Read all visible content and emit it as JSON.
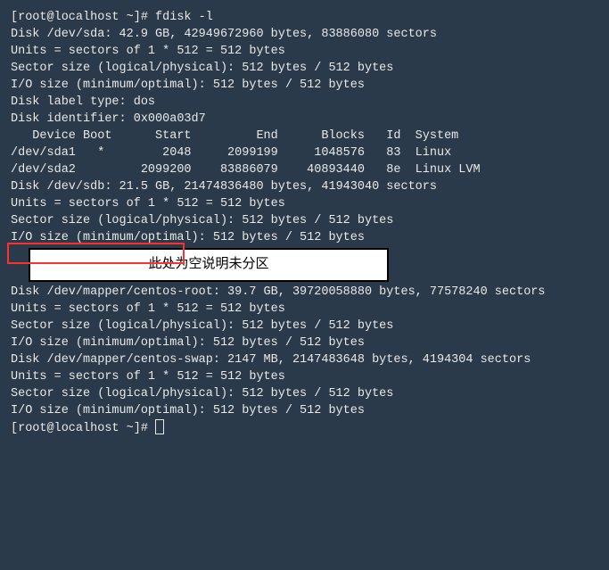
{
  "prompt1": "[root@localhost ~]# fdisk -l",
  "blank": "",
  "sda": {
    "disk": "Disk /dev/sda: 42.9 GB, 42949672960 bytes, 83886080 sectors",
    "units": "Units = sectors of 1 * 512 = 512 bytes",
    "sector": "Sector size (logical/physical): 512 bytes / 512 bytes",
    "io": "I/O size (minimum/optimal): 512 bytes / 512 bytes",
    "labeltype": "Disk label type: dos",
    "identifier": "Disk identifier: 0x000a03d7"
  },
  "partitions": {
    "header": "   Device Boot      Start         End      Blocks   Id  System",
    "p1": "/dev/sda1   *        2048     2099199     1048576   83  Linux",
    "p2": "/dev/sda2         2099200    83886079    40893440   8e  Linux LVM"
  },
  "sdb": {
    "disk_part1": "Disk /dev/sdb: 21.5 GB",
    "disk_part2": ", 21474836480 bytes, 41943040 sectors",
    "units": "Units = sectors of 1 * 512 = 512 bytes",
    "sector": "Sector size (logical/physical): 512 bytes / 512 bytes",
    "io": "I/O size (minimum/optimal): 512 bytes / 512 bytes"
  },
  "annotation": "此处为空说明未分区",
  "mapper_root": {
    "disk": "Disk /dev/mapper/centos-root: 39.7 GB, 39720058880 bytes, 77578240 sectors",
    "units": "Units = sectors of 1 * 512 = 512 bytes",
    "sector": "Sector size (logical/physical): 512 bytes / 512 bytes",
    "io": "I/O size (minimum/optimal): 512 bytes / 512 bytes"
  },
  "mapper_swap": {
    "disk": "Disk /dev/mapper/centos-swap: 2147 MB, 2147483648 bytes, 4194304 sectors",
    "units": "Units = sectors of 1 * 512 = 512 bytes",
    "sector": "Sector size (logical/physical): 512 bytes / 512 bytes",
    "io": "I/O size (minimum/optimal): 512 bytes / 512 bytes"
  },
  "prompt2": "[root@localhost ~]# "
}
